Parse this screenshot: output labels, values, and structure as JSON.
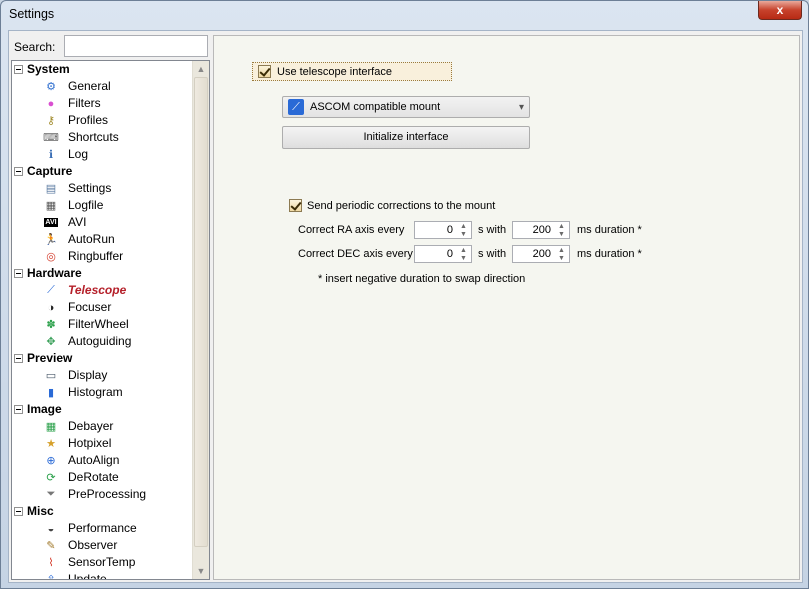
{
  "window": {
    "title": "Settings",
    "close_glyph": "x"
  },
  "search": {
    "label": "Search:",
    "value": "",
    "placeholder": ""
  },
  "tree": {
    "groups": [
      {
        "label": "System",
        "items": [
          {
            "label": "General",
            "icon": "gear-icon"
          },
          {
            "label": "Filters",
            "icon": "color-wheel-icon"
          },
          {
            "label": "Profiles",
            "icon": "key-icon"
          },
          {
            "label": "Shortcuts",
            "icon": "keyboard-icon"
          },
          {
            "label": "Log",
            "icon": "info-log-icon"
          }
        ]
      },
      {
        "label": "Capture",
        "items": [
          {
            "label": "Settings",
            "icon": "capture-settings-icon"
          },
          {
            "label": "Logfile",
            "icon": "logfile-icon"
          },
          {
            "label": "AVI",
            "icon": "avi-icon",
            "glyph": "AVI"
          },
          {
            "label": "AutoRun",
            "icon": "runner-icon"
          },
          {
            "label": "Ringbuffer",
            "icon": "lifebuoy-icon"
          }
        ]
      },
      {
        "label": "Hardware",
        "items": [
          {
            "label": "Telescope",
            "icon": "telescope-icon",
            "selected": true
          },
          {
            "label": "Focuser",
            "icon": "focuser-icon"
          },
          {
            "label": "FilterWheel",
            "icon": "filterwheel-icon"
          },
          {
            "label": "Autoguiding",
            "icon": "autoguiding-icon"
          }
        ]
      },
      {
        "label": "Preview",
        "items": [
          {
            "label": "Display",
            "icon": "monitor-icon"
          },
          {
            "label": "Histogram",
            "icon": "histogram-icon"
          }
        ]
      },
      {
        "label": "Image",
        "items": [
          {
            "label": "Debayer",
            "icon": "debayer-grid-icon"
          },
          {
            "label": "Hotpixel",
            "icon": "hotpixel-star-icon"
          },
          {
            "label": "AutoAlign",
            "icon": "autoalign-icon"
          },
          {
            "label": "DeRotate",
            "icon": "derotate-icon"
          },
          {
            "label": "PreProcessing",
            "icon": "funnel-icon"
          }
        ]
      },
      {
        "label": "Misc",
        "items": [
          {
            "label": "Performance",
            "icon": "performance-gauge-icon"
          },
          {
            "label": "Observer",
            "icon": "observer-icon"
          },
          {
            "label": "SensorTemp",
            "icon": "thermometer-icon"
          },
          {
            "label": "Update",
            "icon": "update-icon"
          }
        ]
      }
    ]
  },
  "telescope": {
    "use_interface_label": "Use telescope interface",
    "use_interface_checked": true,
    "mount_selected": "ASCOM compatible mount",
    "initialize_label": "Initialize interface",
    "periodic_label": "Send periodic corrections to the mount",
    "periodic_checked": true,
    "ra": {
      "label": "Correct RA axis every",
      "interval": "0",
      "unit_with": "s with",
      "duration": "200",
      "unit_duration": "ms duration *"
    },
    "dec": {
      "label": "Correct DEC axis every",
      "interval": "0",
      "unit_with": "s with",
      "duration": "200",
      "unit_duration": "ms duration *"
    },
    "note": "* insert negative duration to swap direction"
  },
  "colors": {
    "selected_item": "#b5202a",
    "close_button": "#c7422c",
    "panel_bg": "#f5f6f0"
  }
}
